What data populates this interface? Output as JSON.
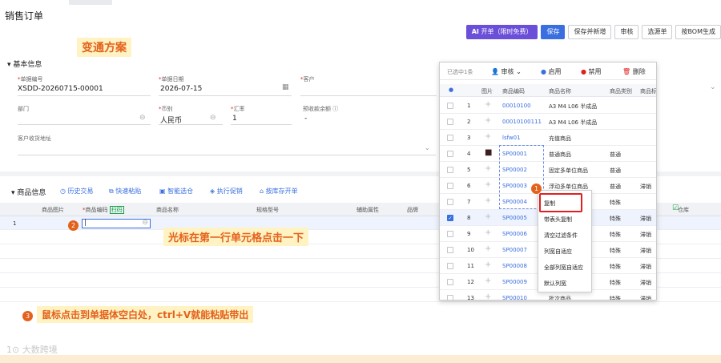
{
  "page": {
    "title": "销售订单"
  },
  "toolbar": {
    "ai_label": "开单（限时免费）",
    "save_label": "保存",
    "save_new_label": "保存并新增",
    "audit_label": "审核",
    "select_label": "选源单",
    "bom_label": "按BOM生成"
  },
  "notes": {
    "plan": "变通方案",
    "step2": "光标在第一行单元格点击一下",
    "step3": "鼠标点击到单据体空白处，ctrl+V就能粘贴带出",
    "badge1": "1",
    "badge2": "2",
    "badge3": "3"
  },
  "basic": {
    "section_title": "基本信息",
    "doc_no_label": "单据编号",
    "doc_no": "XSDD-20260715-00001",
    "date_label": "单据日期",
    "date": "2026-07-15",
    "customer_label": "客户",
    "dept_label": "部门",
    "currency_label": "币别",
    "currency": "人民币",
    "rate_label": "汇率",
    "rate": "1",
    "prepay_label": "预收款余额",
    "prepay": "-",
    "address_label": "客户收货地址"
  },
  "goods": {
    "section_title": "商品信息",
    "tools": [
      "历史交易",
      "快速粘贴",
      "智能选仓",
      "执行促销",
      "按库存开单"
    ],
    "columns": {
      "image": "商品图片",
      "code": "商品编码",
      "scan": "扫码",
      "name": "商品名称",
      "spec": "规格型号",
      "aux": "辅助属性",
      "brand": "品牌"
    },
    "first_row_no": "1"
  },
  "popup": {
    "selected": "已选中1条",
    "audit": "审核",
    "enable": "启用",
    "disable": "禁用",
    "delete": "删除",
    "header": {
      "image": "图片",
      "code": "商品编码",
      "name": "商品名称",
      "category": "商品类别",
      "tag": "商品标"
    },
    "rows": [
      {
        "no": "1",
        "code": "00010100",
        "name": "A3 M4 L06 半成品",
        "category": "",
        "tag": "",
        "checked": false
      },
      {
        "no": "2",
        "code": "00010100111",
        "name": "A3 M4 L06 半成品",
        "category": "",
        "tag": "",
        "checked": false
      },
      {
        "no": "3",
        "code": "lsfw01",
        "name": "充值商品",
        "category": "",
        "tag": "",
        "checked": false
      },
      {
        "no": "4",
        "code": "SP00001",
        "name": "普通商品",
        "category": "普通",
        "tag": "",
        "checked": false
      },
      {
        "no": "5",
        "code": "SP00002",
        "name": "固定多单位商品",
        "category": "普通",
        "tag": "",
        "checked": false
      },
      {
        "no": "6",
        "code": "SP00003",
        "name": "浮动多单位商品",
        "category": "普通",
        "tag": "滞销",
        "checked": false
      },
      {
        "no": "7",
        "code": "SP00004",
        "name": "",
        "category": "特殊",
        "tag": "",
        "checked": false
      },
      {
        "no": "8",
        "code": "SP00005",
        "name": "",
        "category": "特殊",
        "tag": "滞销",
        "checked": true
      },
      {
        "no": "9",
        "code": "SP00006",
        "name": "",
        "category": "特殊",
        "tag": "滞销",
        "checked": false
      },
      {
        "no": "10",
        "code": "SP00007",
        "name": "",
        "category": "特殊",
        "tag": "滞销",
        "checked": false
      },
      {
        "no": "11",
        "code": "SP00008",
        "name": "",
        "category": "特殊",
        "tag": "滞销",
        "checked": false
      },
      {
        "no": "12",
        "code": "SP00009",
        "name": "",
        "category": "特殊",
        "tag": "滞销",
        "checked": false
      },
      {
        "no": "13",
        "code": "SP00010",
        "name": "批次商品",
        "category": "特殊",
        "tag": "滞销",
        "checked": false
      }
    ]
  },
  "context_menu": [
    "复制",
    "带表头复制",
    "清空过滤条件",
    "列宽自适应",
    "全部列宽自适应",
    "默认列宽"
  ],
  "right_partial": {
    "warehouse": "仓库"
  },
  "watermark": "大数跨境"
}
